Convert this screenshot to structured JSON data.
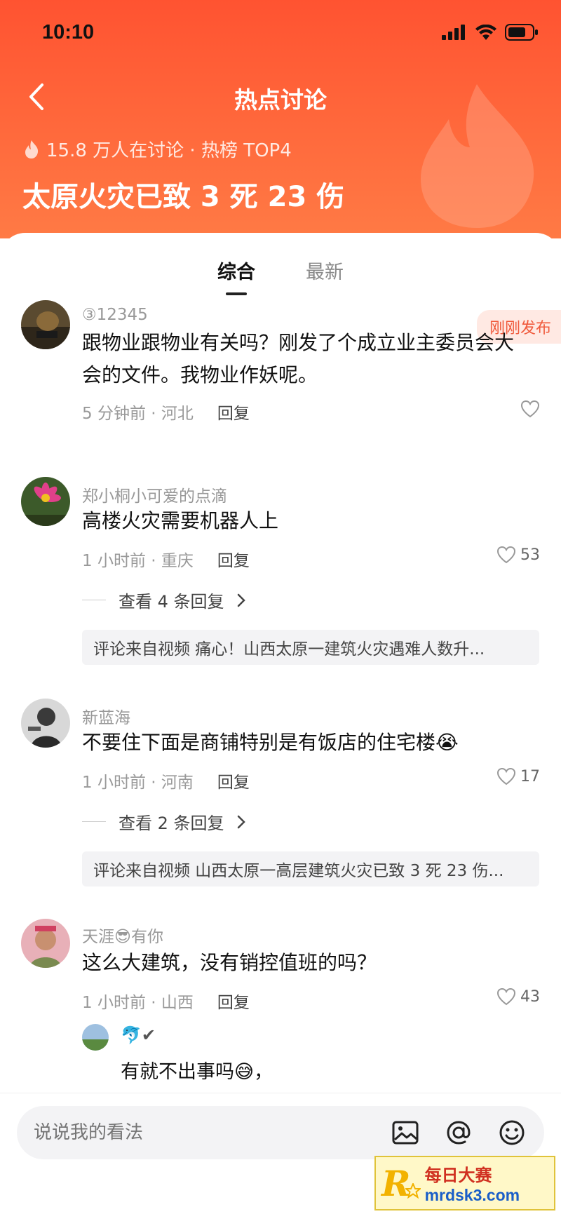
{
  "status_bar": {
    "time": "10:10"
  },
  "nav": {
    "title": "热点讨论"
  },
  "topic": {
    "heat_text": "15.8 万人在讨论 · 热榜 TOP4",
    "title": "太原火灾已致 3 死 23 伤"
  },
  "tabs": [
    {
      "label": "综合",
      "active": true
    },
    {
      "label": "最新",
      "active": false
    }
  ],
  "badge_new": "刚刚发布",
  "comments": [
    {
      "user": "③12345",
      "text": "跟物业跟物业有关吗？刚发了个成立业主委员会大会的文件。我物业作妖呢。",
      "meta": "5 分钟前 · 河北",
      "reply_label": "回复",
      "likes": ""
    },
    {
      "user": "郑小桐小可爱的点滴",
      "text": "高楼火灾需要机器人上",
      "meta": "1 小时前 · 重庆",
      "reply_label": "回复",
      "likes": "53",
      "view_replies": "查看 4 条回复",
      "source": "评论来自视频 痛心！山西太原一建筑火灾遇难人数升..."
    },
    {
      "user": "新蓝海",
      "text": "不要住下面是商铺特别是有饭店的住宅楼😭",
      "meta": "1 小时前 · 河南",
      "reply_label": "回复",
      "likes": "17",
      "view_replies": "查看 2 条回复",
      "source": "评论来自视频 山西太原一高层建筑火灾已致 3 死 23 伤..."
    },
    {
      "user_prefix": "天涯",
      "user_emoji": "😎",
      "user_suffix": "有你",
      "text": "这么大建筑，没有销控值班的吗？",
      "meta": "1 小时前 · 山西",
      "reply_label": "回复",
      "likes": "43",
      "sub_reply": {
        "user": "🐬✔",
        "text": "有就不出事吗😅，"
      }
    }
  ],
  "composer": {
    "placeholder": "说说我的看法"
  },
  "watermark": {
    "letter": "R",
    "cn": "每日大赛",
    "url": "mrdsk3.com"
  },
  "colors": {
    "header": "#ff5331",
    "accent": "#f05a3c"
  }
}
